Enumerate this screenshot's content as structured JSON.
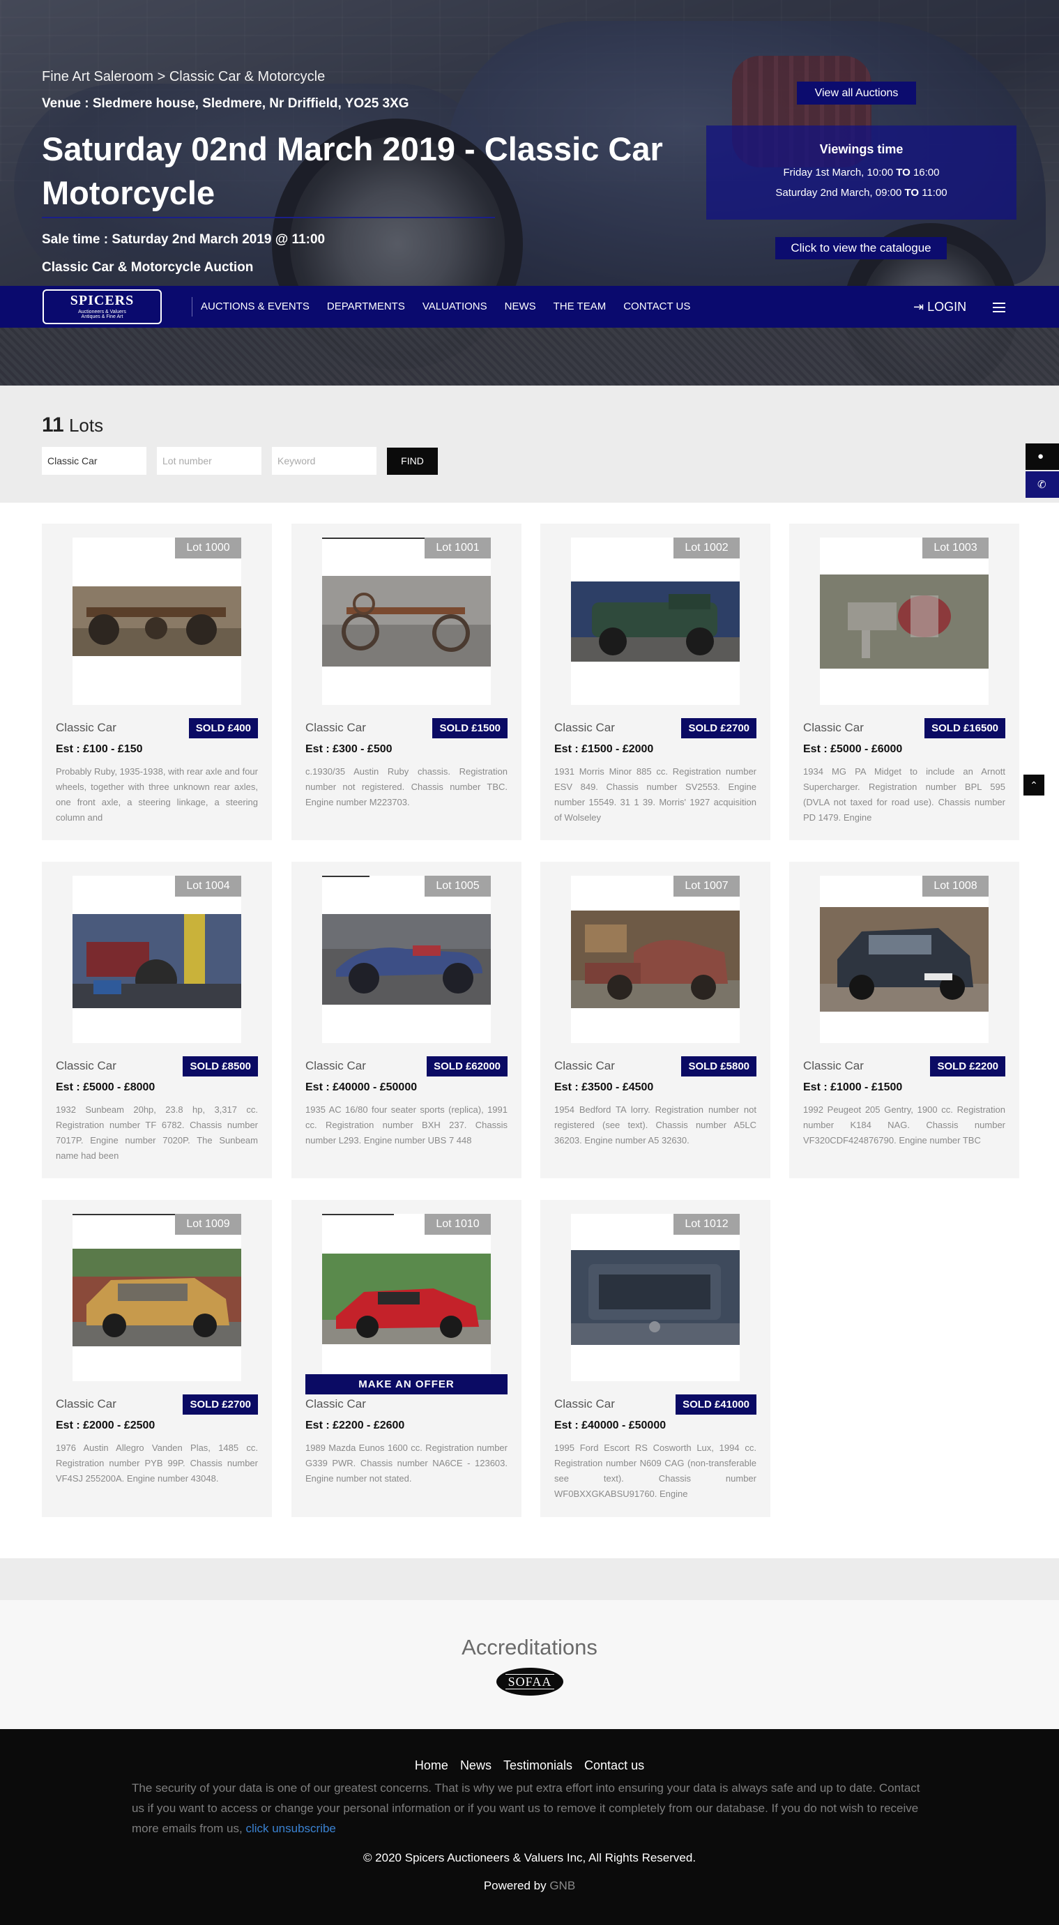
{
  "hero": {
    "breadcrumb": "Fine Art Saleroom > Classic Car & Motorcycle",
    "venue": "Venue : Sledmere house, Sledmere, Nr Driffield, YO25 3XG",
    "title": "Saturday 02nd March 2019 - Classic Car Motorcycle",
    "sale_time": "Sale time : Saturday 2nd March 2019 @ 11:00",
    "auction_name": "Classic Car & Motorcycle Auction",
    "view_all_label": "View all Auctions",
    "viewings_title": "Viewings time",
    "viewing_1_pre": "Friday 1st March, 10:00 ",
    "viewing_1_to": "TO",
    "viewing_1_post": " 16:00",
    "viewing_2_pre": "Saturday 2nd March, 09:00 ",
    "viewing_2_to": "TO",
    "viewing_2_post": " 11:00",
    "catalogue_label": "Click to view the catalogue"
  },
  "nav": {
    "logo_name": "SPICERS",
    "logo_line2": "Auctioneers & Valuers",
    "logo_line3": "Antiques & Fine Art",
    "items": [
      "AUCTIONS & EVENTS",
      "DEPARTMENTS",
      "VALUATIONS",
      "NEWS",
      "THE TEAM",
      "CONTACT US"
    ],
    "login_icon": "login-icon",
    "login": "LOGIN",
    "menu_icon": "hamburger-icon"
  },
  "filter": {
    "count": "11",
    "count_label": "Lots",
    "category_value": "Classic Car",
    "lot_placeholder": "Lot number",
    "keyword_placeholder": "Keyword",
    "find_label": "FIND"
  },
  "side": {
    "map_icon": "map-marker-icon",
    "phone_icon": "phone-icon",
    "scroll_icon": "chevron-up-icon"
  },
  "lots": [
    {
      "lot": "Lot 1000",
      "category": "Classic Car",
      "status": "SOLD £400",
      "estimate": "Est : £100 - £150",
      "description": "Probably Ruby, 1935-1938, with rear axle and four wheels, together with three unknown rear axles, one front axle, a steering linkage, a steering column and"
    },
    {
      "lot": "Lot 1001",
      "category": "Classic Car",
      "status": "SOLD £1500",
      "estimate": "Est : £300 - £500",
      "description": "c.1930/35 Austin Ruby chassis. Registration number not registered. Chassis number TBC. Engine number M223703."
    },
    {
      "lot": "Lot 1002",
      "category": "Classic Car",
      "status": "SOLD £2700",
      "estimate": "Est : £1500 - £2000",
      "description": "1931 Morris Minor 885 cc. Registration number ESV 849. Chassis number SV2553. Engine number 15549. 31 1 39. Morris' 1927 acquisition of Wolseley"
    },
    {
      "lot": "Lot 1003",
      "category": "Classic Car",
      "status": "SOLD £16500",
      "estimate": "Est : £5000 - £6000",
      "description": "1934 MG PA Midget to include an Arnott Supercharger. Registration number BPL 595 (DVLA not taxed for road use). Chassis number PD 1479. Engine"
    },
    {
      "lot": "Lot 1004",
      "category": "Classic Car",
      "status": "SOLD £8500",
      "estimate": "Est : £5000 - £8000",
      "description": "1932 Sunbeam 20hp, 23.8 hp, 3,317 cc. Registration number TF 6782. Chassis number 7017P. Engine number 7020P. The Sunbeam name had been"
    },
    {
      "lot": "Lot 1005",
      "category": "Classic Car",
      "status": "SOLD £62000",
      "estimate": "Est : £40000 - £50000",
      "description": "1935 AC 16/80 four seater sports (replica), 1991 cc. Registration number BXH 237. Chassis number L293. Engine number UBS 7 448"
    },
    {
      "lot": "Lot 1007",
      "category": "Classic Car",
      "status": "SOLD £5800",
      "estimate": "Est : £3500 - £4500",
      "description": "1954 Bedford TA lorry. Registration number not registered (see text). Chassis number A5LC 36203. Engine number A5 32630."
    },
    {
      "lot": "Lot 1008",
      "category": "Classic Car",
      "status": "SOLD £2200",
      "estimate": "Est : £1000 - £1500",
      "description": "1992 Peugeot 205 Gentry, 1900 cc. Registration number K184 NAG. Chassis number VF320CDF424876790. Engine number TBC"
    },
    {
      "lot": "Lot 1009",
      "category": "Classic Car",
      "status": "SOLD £2700",
      "estimate": "Est : £2000 - £2500",
      "description": "1976 Austin Allegro Vanden Plas, 1485 cc. Registration number PYB 99P. Chassis number VF4SJ 255200A. Engine number 43048."
    },
    {
      "lot": "Lot 1010",
      "category": "Classic Car",
      "status": "",
      "offer": "MAKE AN OFFER",
      "estimate": "Est : £2200 - £2600",
      "description": "1989 Mazda Eunos 1600 cc. Registration number G339 PWR. Chassis number NA6CE - 123603. Engine number not stated."
    },
    {
      "lot": "Lot 1012",
      "category": "Classic Car",
      "status": "SOLD £41000",
      "estimate": "Est : £40000 - £50000",
      "description": "1995 Ford Escort RS Cosworth Lux, 1994 cc. Registration number N609 CAG (non-transferable see text). Chassis number WF0BXXGKABSU91760. Engine"
    }
  ],
  "accreditations": {
    "title": "Accreditations",
    "logo_text": "SOFAA"
  },
  "footer": {
    "links": [
      "Home",
      "News",
      "Testimonials",
      "Contact us"
    ],
    "privacy": "The security of your data is one of our greatest concerns. That is why we put extra effort into ensuring your data is always safe and up to date. Contact us if you want to access or change your personal information or if you want us to remove it completely from our database. If you do not wish to receive more emails from us, ",
    "unsubscribe": "click unsubscribe",
    "copyright": "© 2020 Spicers Auctioneers & Valuers Inc, All Rights Reserved.",
    "powered_by": "Powered by ",
    "powered_name": "GNB"
  },
  "colors": {
    "brand_navy": "#0a0a6e",
    "sold_badge": "#0b0b64",
    "lot_badge": "#a3a3a3",
    "footer_bg": "#0b0b0b",
    "link_blue": "#3b82d1"
  }
}
